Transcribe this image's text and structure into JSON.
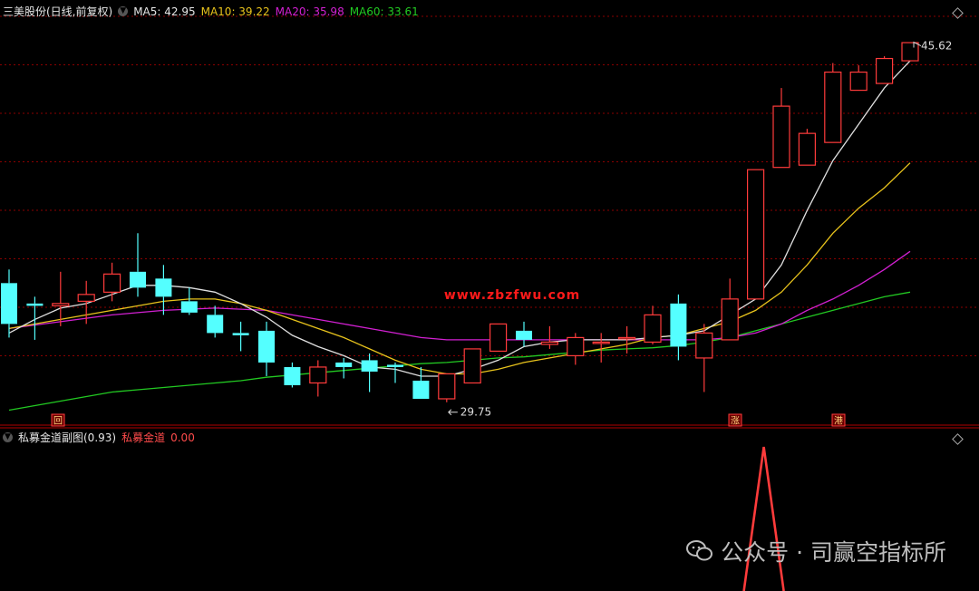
{
  "header": {
    "stock_title": "三美股份(日线,前复权)",
    "ma5": "MA5: 42.95",
    "ma10": "MA10: 39.22",
    "ma20": "MA20: 35.98",
    "ma60": "MA60: 33.61"
  },
  "indicator": {
    "title": "私募金道副图(0.93)",
    "series_label": "私募金道",
    "value": "0.00"
  },
  "markers": {
    "high_label": "45.62",
    "low_label": "29.75",
    "hui": "回",
    "zhang": "涨",
    "gang": "港"
  },
  "watermark": {
    "site": "www.zbzfwu.com",
    "account": "公众号 · 司赢空指标所"
  },
  "colors": {
    "up": "#ff3b3b",
    "down": "#54ffff",
    "ma5": "#e0e0e0",
    "ma10": "#e8c31c",
    "ma20": "#d220d2",
    "ma60": "#22c922",
    "grid": "#8b0000"
  },
  "chart_data": [
    {
      "type": "candlestick",
      "title": "三美股份(日线,前复权)",
      "ohlc": [
        [
          35.0,
          35.6,
          32.6,
          33.2
        ],
        [
          34.1,
          34.4,
          32.5,
          34.0
        ],
        [
          34.0,
          35.5,
          33.1,
          34.1
        ],
        [
          34.2,
          35.1,
          33.2,
          34.5
        ],
        [
          34.6,
          35.9,
          34.2,
          35.4
        ],
        [
          35.5,
          37.2,
          34.4,
          34.8
        ],
        [
          35.2,
          35.8,
          33.6,
          34.4
        ],
        [
          34.2,
          34.8,
          33.6,
          33.7
        ],
        [
          33.6,
          34.0,
          32.6,
          32.8
        ],
        [
          32.8,
          33.3,
          32.0,
          32.7
        ],
        [
          32.9,
          33.3,
          30.9,
          31.5
        ],
        [
          31.3,
          31.5,
          30.4,
          30.5
        ],
        [
          30.6,
          31.6,
          30.0,
          31.3
        ],
        [
          31.5,
          31.7,
          30.8,
          31.3
        ],
        [
          31.6,
          31.9,
          30.2,
          31.1
        ],
        [
          31.4,
          31.5,
          30.6,
          31.3
        ],
        [
          30.7,
          31.3,
          29.9,
          29.9
        ],
        [
          29.9,
          31.0,
          29.75,
          31.0
        ],
        [
          30.6,
          32.1,
          30.6,
          32.1
        ],
        [
          32.0,
          33.2,
          32.0,
          33.2
        ],
        [
          32.9,
          33.3,
          32.2,
          32.5
        ],
        [
          32.3,
          33.1,
          32.1,
          32.4
        ],
        [
          31.8,
          32.8,
          31.4,
          32.6
        ],
        [
          32.4,
          32.8,
          31.5,
          32.4
        ],
        [
          32.6,
          33.1,
          31.9,
          32.6
        ],
        [
          32.4,
          34.0,
          32.3,
          33.6
        ],
        [
          34.1,
          34.5,
          31.6,
          32.2
        ],
        [
          31.7,
          33.2,
          30.2,
          32.8
        ],
        [
          32.5,
          35.2,
          32.5,
          34.3
        ],
        [
          34.3,
          40.0,
          34.3,
          40.0
        ],
        [
          40.1,
          43.6,
          40.1,
          42.8
        ],
        [
          40.2,
          41.8,
          40.2,
          41.6
        ],
        [
          41.2,
          44.7,
          41.2,
          44.3
        ],
        [
          43.5,
          44.6,
          43.5,
          44.3
        ],
        [
          43.8,
          45.0,
          43.8,
          44.9
        ],
        [
          44.8,
          45.62,
          44.8,
          45.6
        ]
      ],
      "ma5": [
        32.8,
        33.4,
        33.9,
        34.1,
        34.5,
        34.9,
        34.9,
        34.8,
        34.6,
        34.1,
        33.5,
        32.7,
        32.2,
        31.8,
        31.3,
        31.2,
        30.9,
        30.9,
        31.2,
        31.6,
        32.2,
        32.4,
        32.5,
        32.5,
        32.5,
        32.6,
        32.7,
        32.9,
        33.6,
        34.3,
        35.8,
        38.2,
        40.4,
        42.0,
        43.6,
        44.8
      ],
      "ma10": [
        33.0,
        33.2,
        33.4,
        33.6,
        33.8,
        34.0,
        34.2,
        34.3,
        34.3,
        34.1,
        33.8,
        33.4,
        33.0,
        32.6,
        32.1,
        31.6,
        31.2,
        31.0,
        31.0,
        31.2,
        31.5,
        31.7,
        31.9,
        32.1,
        32.3,
        32.6,
        32.7,
        33.0,
        33.3,
        33.8,
        34.6,
        35.8,
        37.2,
        38.3,
        39.2,
        40.3
      ],
      "ma20": [
        33.0,
        33.15,
        33.3,
        33.45,
        33.6,
        33.7,
        33.8,
        33.85,
        33.9,
        33.85,
        33.8,
        33.6,
        33.4,
        33.2,
        33.0,
        32.8,
        32.6,
        32.5,
        32.5,
        32.5,
        32.5,
        32.5,
        32.5,
        32.5,
        32.5,
        32.5,
        32.5,
        32.5,
        32.6,
        32.8,
        33.2,
        33.8,
        34.3,
        34.9,
        35.6,
        36.4
      ],
      "ma60": [
        29.4,
        29.6,
        29.8,
        30.0,
        30.2,
        30.3,
        30.4,
        30.5,
        30.6,
        30.7,
        30.85,
        30.95,
        31.05,
        31.15,
        31.25,
        31.35,
        31.45,
        31.5,
        31.6,
        31.7,
        31.75,
        31.85,
        31.95,
        32.05,
        32.1,
        32.15,
        32.25,
        32.4,
        32.6,
        32.9,
        33.2,
        33.5,
        33.8,
        34.1,
        34.4,
        34.6
      ],
      "high_value": 45.62,
      "low_value": 29.75,
      "ylim": [
        29.3,
        46.6
      ]
    },
    {
      "type": "line",
      "title": "私募金道副图(0.93)",
      "series": [
        {
          "name": "私募金道",
          "values": [
            0,
            0,
            0,
            0,
            0,
            0,
            0,
            0,
            0,
            0,
            0,
            0,
            0,
            0,
            0,
            0,
            0,
            0,
            0,
            0,
            0,
            0,
            0,
            0,
            0,
            0,
            0,
            0,
            0,
            1,
            0,
            0,
            0,
            0,
            0,
            0
          ]
        }
      ],
      "ylim": [
        0,
        1
      ]
    }
  ]
}
